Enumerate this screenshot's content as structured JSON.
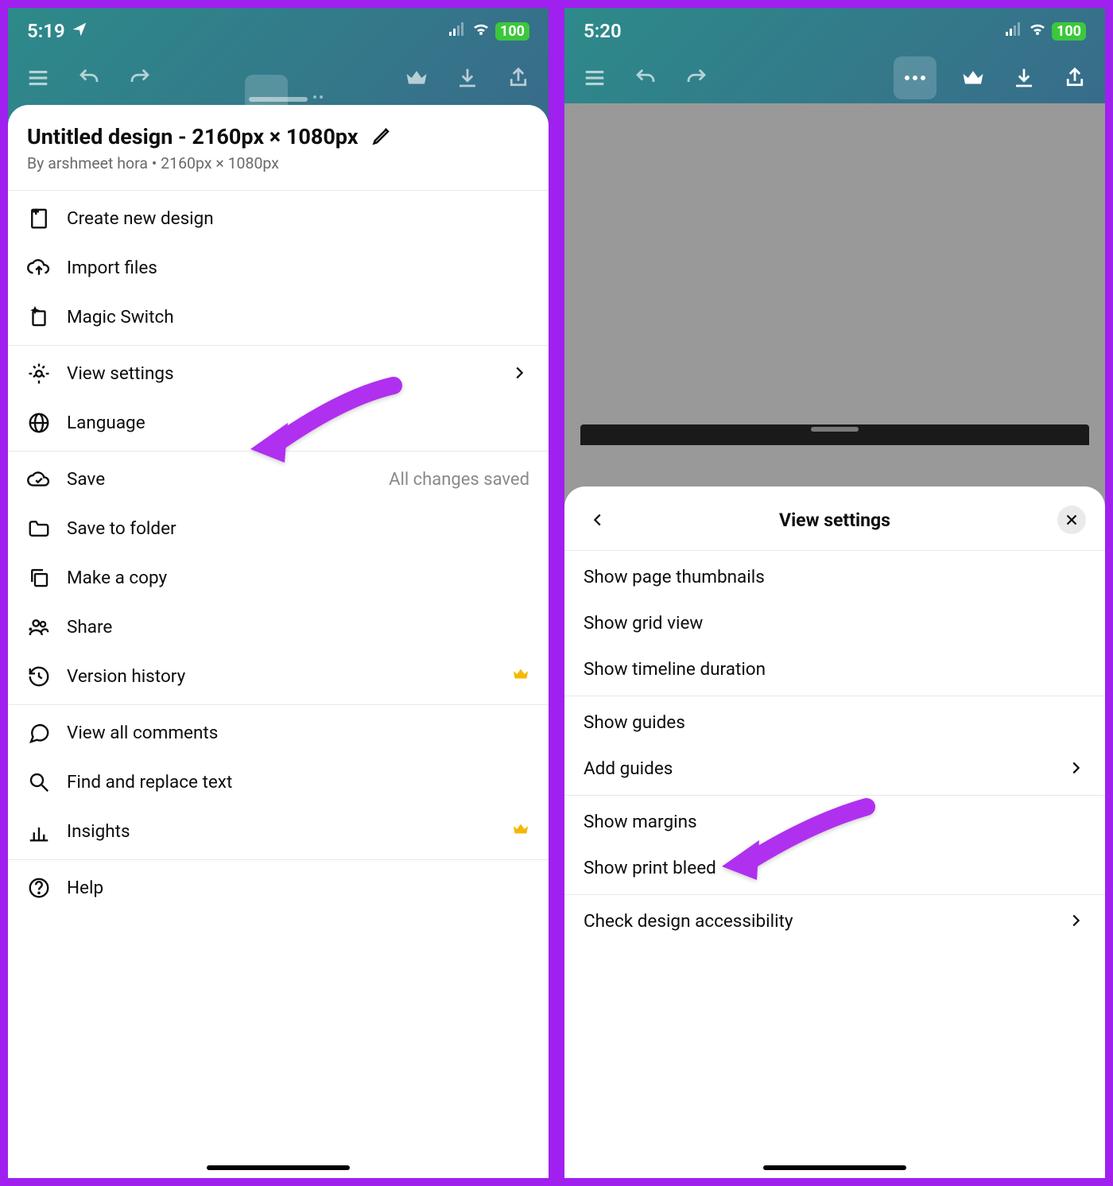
{
  "left": {
    "status": {
      "time": "5:19",
      "battery": "100"
    },
    "sheet": {
      "title": "Untitled design - 2160px × 1080px",
      "byline": "By arshmeet hora • 2160px × 1080px",
      "group1": {
        "create": "Create new design",
        "import": "Import files",
        "magic": "Magic Switch"
      },
      "group2": {
        "view_settings": "View settings",
        "language": "Language"
      },
      "group3": {
        "save": "Save",
        "save_status": "All changes saved",
        "save_folder": "Save to folder",
        "copy": "Make a copy",
        "share": "Share",
        "version": "Version history"
      },
      "group4": {
        "comments": "View all comments",
        "find": "Find and replace text",
        "insights": "Insights"
      },
      "group5": {
        "help": "Help"
      }
    }
  },
  "right": {
    "status": {
      "time": "5:20",
      "battery": "100"
    },
    "sheet": {
      "title": "View settings",
      "g1": {
        "thumbs": "Show page thumbnails",
        "grid": "Show grid view",
        "timeline": "Show timeline duration"
      },
      "g2": {
        "guides": "Show guides",
        "add_guides": "Add guides"
      },
      "g3": {
        "margins": "Show margins",
        "bleed": "Show print bleed"
      },
      "g4": {
        "access": "Check design accessibility"
      }
    }
  }
}
